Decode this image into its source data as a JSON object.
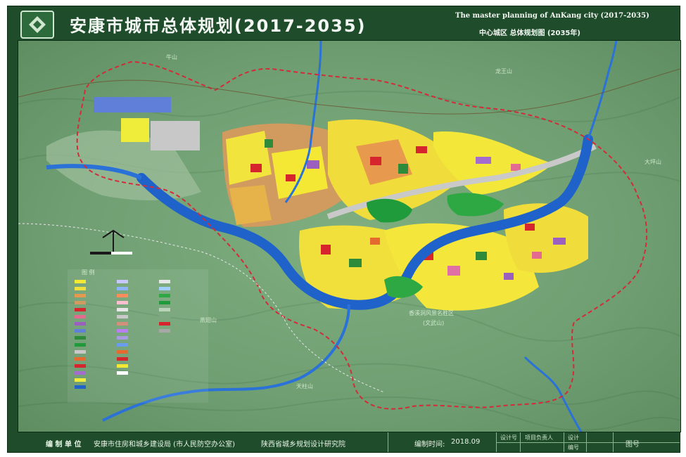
{
  "header": {
    "title_cn": "安康市城市总体规划(2017-2035)",
    "title_en": "The master planning of AnKang city  (2017-2035)",
    "subtitle": "中心城区  总体规划图  (2035年)"
  },
  "map": {
    "labels": {
      "m1": "牛山",
      "m2": "龙王山",
      "m3": "大坪山",
      "m4": "香溪洞风景名胜区",
      "m5": "(文武山)",
      "m6": "燕翅山",
      "m7": "天柱山"
    },
    "legend_title": "图 例"
  },
  "footer": {
    "org_label": "编 制 单 位",
    "org_name": "安康市住房和城乡建设局 (市人民防空办公室)",
    "institute": "陕西省城乡规划设计研究院",
    "date_label": "编制时间:",
    "date_value": "2018.09",
    "approval": [
      "设计号",
      "项目负责人",
      "设计",
      "编号",
      "图号"
    ]
  }
}
